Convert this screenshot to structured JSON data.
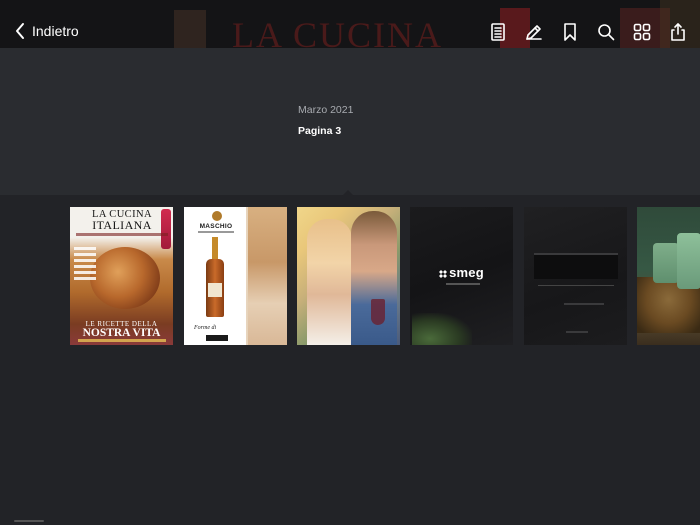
{
  "navigation": {
    "back_label": "Indietro"
  },
  "toolbar": {
    "tools": [
      {
        "name": "page-list-icon"
      },
      {
        "name": "pencil-icon"
      },
      {
        "name": "bookmark-icon"
      },
      {
        "name": "search-icon"
      },
      {
        "name": "grid-icon"
      },
      {
        "name": "share-icon"
      }
    ]
  },
  "background_cover": {
    "title": "LA CUCINA"
  },
  "issue": {
    "date": "Marzo 2021",
    "page_label": "Pagina 3"
  },
  "pages": {
    "cover": {
      "title_line1": "LA CUCINA",
      "title_line2": "ITALIANA",
      "headline_small": "LE RICETTE DELLA",
      "headline_big": "NOSTRA VITA"
    },
    "maschio": {
      "brand": "MASCHIO",
      "script": "Forme di"
    },
    "smeg": {
      "logo": "smeg"
    }
  },
  "colors": {
    "background": "#2a2c30",
    "strip": "#222327",
    "topbar": "#141416",
    "text_primary": "#ffffff",
    "text_secondary": "#a8abb0"
  }
}
